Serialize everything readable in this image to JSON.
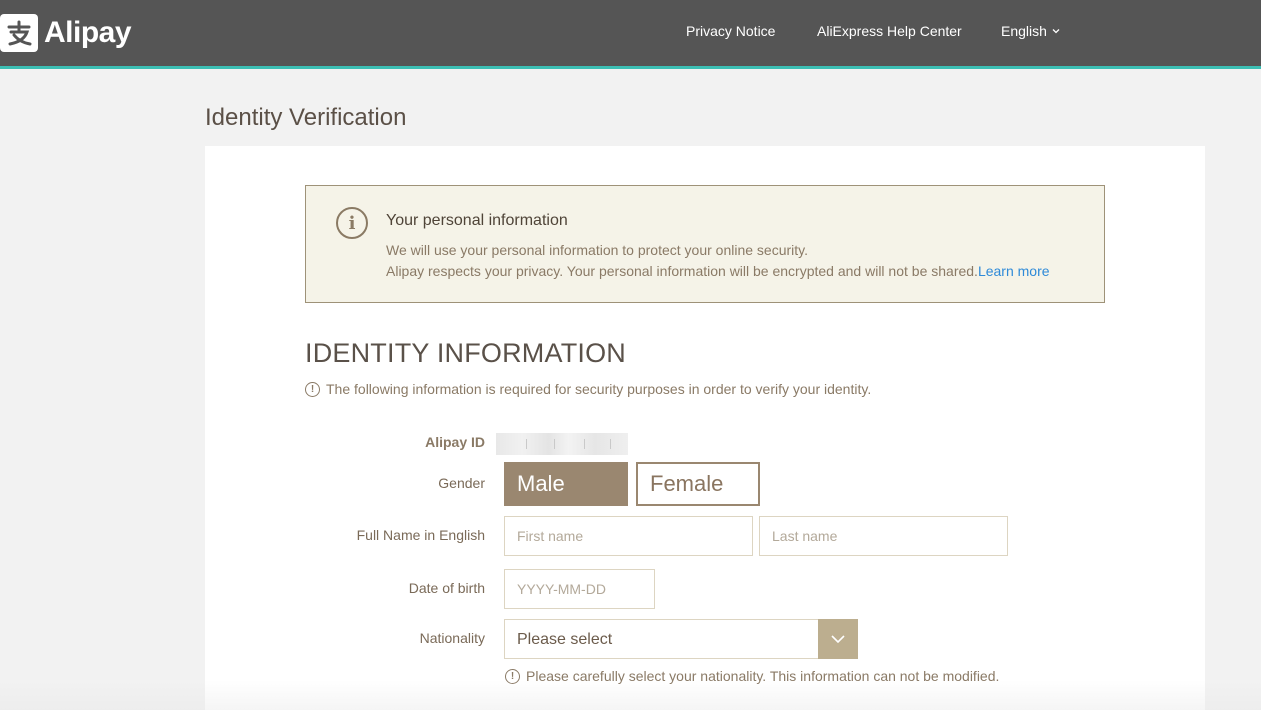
{
  "header": {
    "logo_text": "Alipay",
    "nav": {
      "privacy": "Privacy Notice",
      "help": "AliExpress Help Center",
      "language": "English"
    }
  },
  "page": {
    "title": "Identity Verification"
  },
  "notice": {
    "icon": "info-icon",
    "title": "Your personal information",
    "line1": "We will use your personal information to protect your online security.",
    "line2": "Alipay respects your privacy. Your personal information will be encrypted and will not be shared.",
    "learn_more": "Learn more"
  },
  "section": {
    "title": "IDENTITY INFORMATION",
    "hint": "The following information is required for security purposes in order to verify your identity."
  },
  "form": {
    "alipay_id_label": "Alipay ID",
    "gender_label": "Gender",
    "gender_options": [
      "Male",
      "Female"
    ],
    "gender_selected": "Male",
    "full_name_label": "Full Name in English",
    "first_name_placeholder": "First name",
    "last_name_placeholder": "Last name",
    "dob_label": "Date of birth",
    "dob_placeholder": "YYYY-MM-DD",
    "nationality_label": "Nationality",
    "nationality_value": "Please select",
    "nationality_hint": "Please carefully select your nationality. This information can not be modified."
  },
  "colors": {
    "header_bg": "#555555",
    "accent_line": "#3cbfb4",
    "brand_brown": "#9a8770",
    "link_blue": "#2e8ad8",
    "notice_bg": "#f5f3e8"
  }
}
